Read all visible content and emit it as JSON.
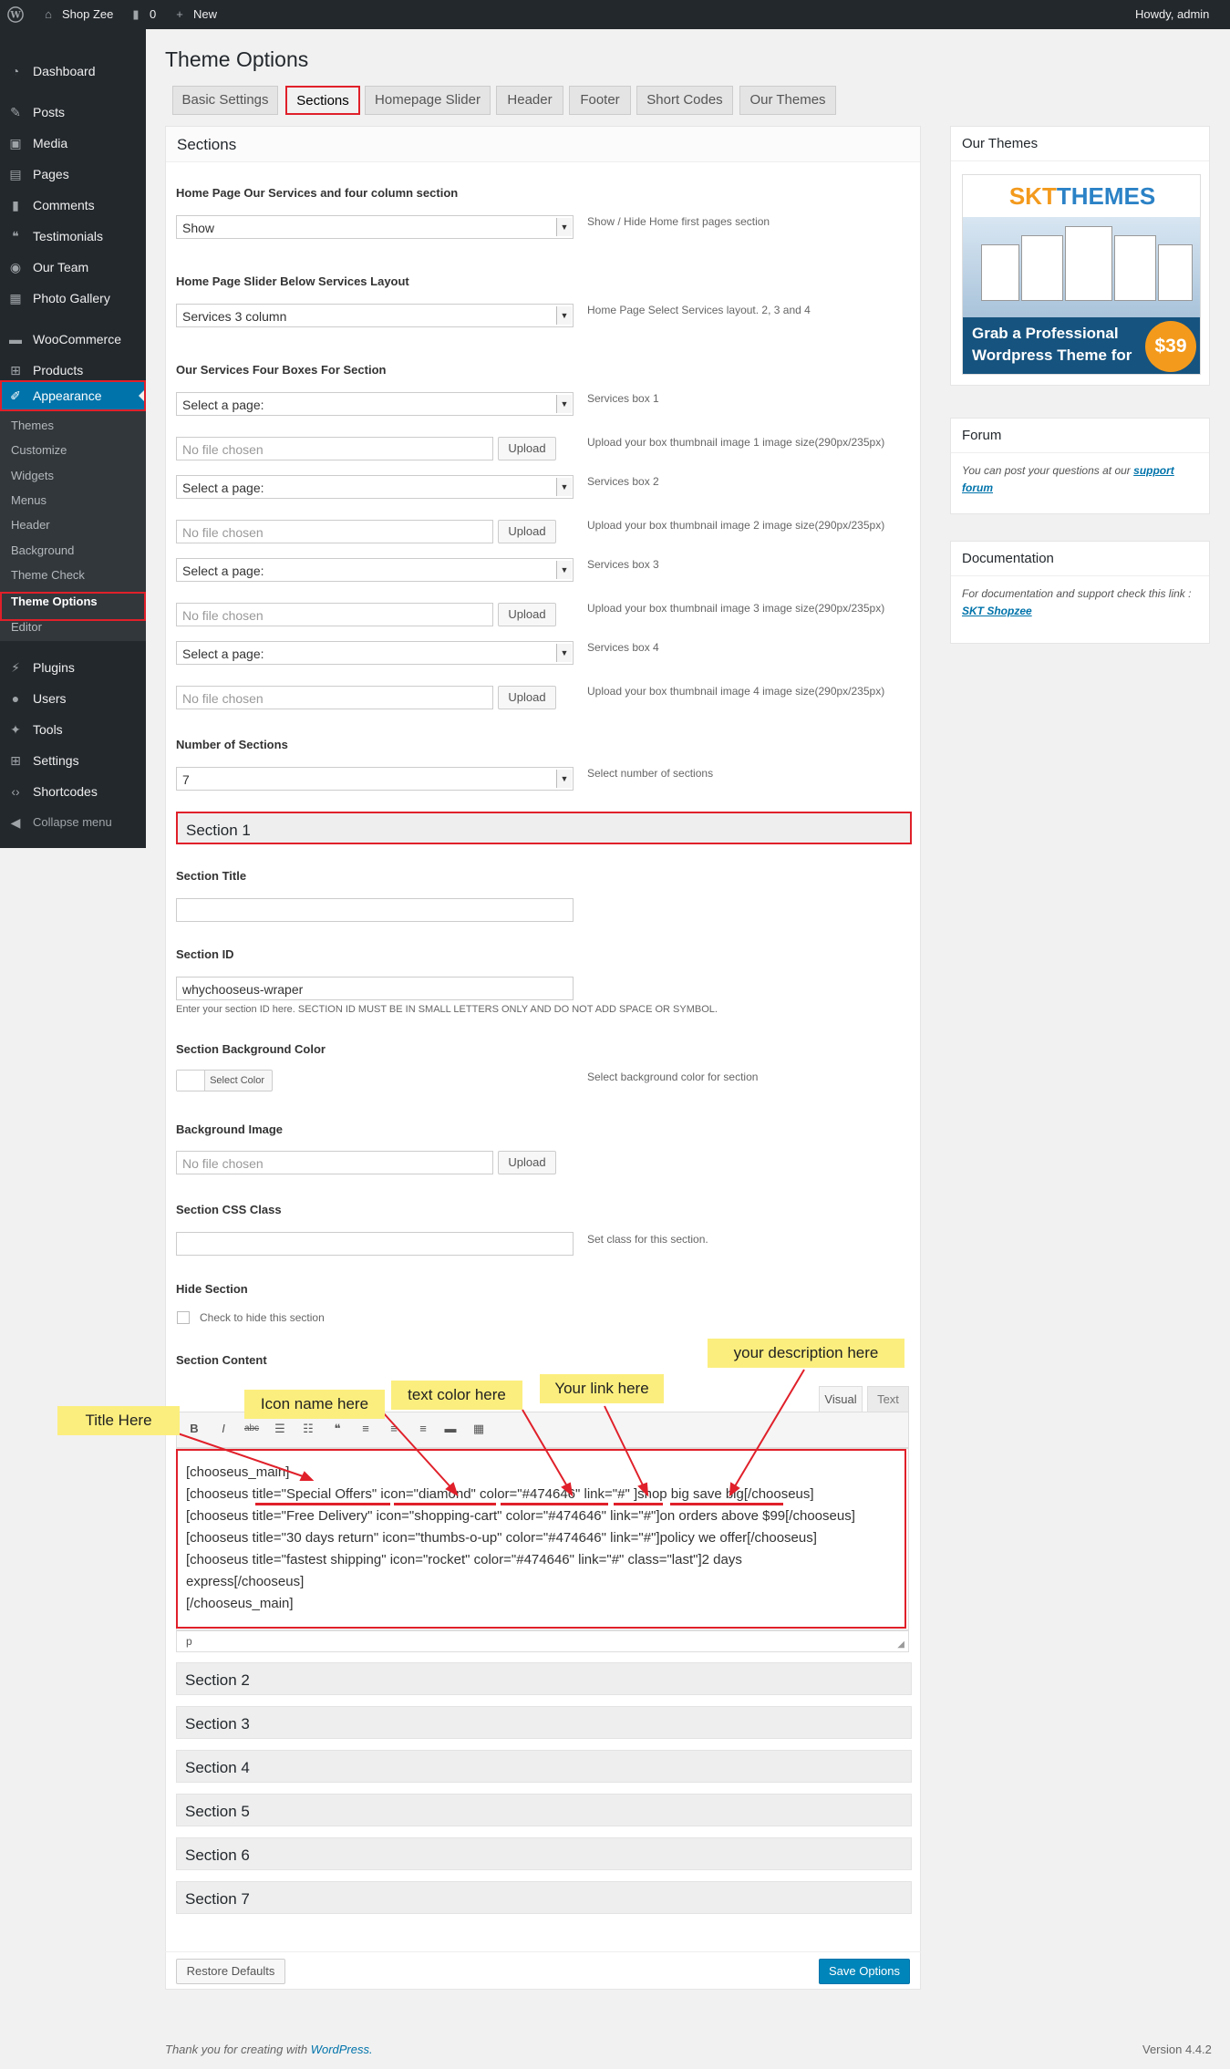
{
  "adminbar": {
    "site": "Shop Zee",
    "comments": "0",
    "new": "New",
    "howdy": "Howdy, admin"
  },
  "sidebar": {
    "items": [
      {
        "label": "Dashboard",
        "icon": "dashboard-icon"
      },
      {
        "label": "Posts",
        "icon": "pin-icon"
      },
      {
        "label": "Media",
        "icon": "media-icon"
      },
      {
        "label": "Pages",
        "icon": "pages-icon"
      },
      {
        "label": "Comments",
        "icon": "comment-icon"
      },
      {
        "label": "Testimonials",
        "icon": "quote-icon"
      },
      {
        "label": "Our Team",
        "icon": "team-icon"
      },
      {
        "label": "Photo Gallery",
        "icon": "gallery-icon"
      },
      {
        "label": "WooCommerce",
        "icon": "woocommerce-icon"
      },
      {
        "label": "Products",
        "icon": "cart-icon"
      },
      {
        "label": "Appearance",
        "icon": "brush-icon"
      }
    ],
    "sub": [
      "Themes",
      "Customize",
      "Widgets",
      "Menus",
      "Header",
      "Background",
      "Theme Check",
      "Theme Options",
      "Editor"
    ],
    "bottom": [
      {
        "label": "Plugins",
        "icon": "plugin-icon"
      },
      {
        "label": "Users",
        "icon": "user-icon"
      },
      {
        "label": "Tools",
        "icon": "wrench-icon"
      },
      {
        "label": "Settings",
        "icon": "settings-icon"
      },
      {
        "label": "Shortcodes",
        "icon": "code-icon"
      },
      {
        "label": "Collapse menu",
        "icon": "collapse-icon"
      }
    ]
  },
  "page": {
    "title": "Theme Options",
    "tabs": [
      "Basic Settings",
      "Sections",
      "Homepage Slider",
      "Header",
      "Footer",
      "Short Codes",
      "Our Themes"
    ],
    "panel_title": "Sections"
  },
  "form": {
    "services_section": {
      "label": "Home Page Our Services and four column section",
      "value": "Show",
      "desc": "Show / Hide Home first pages section"
    },
    "services_layout": {
      "label": "Home Page Slider Below Services Layout",
      "value": "Services 3 column",
      "desc": "Home Page Select Services layout. 2, 3 and 4"
    },
    "boxes_label": "Our Services Four Boxes For Section",
    "boxes": [
      {
        "select": "Select a page:",
        "desc": "Services box 1",
        "file": "No file chosen",
        "upload": "Upload",
        "file_desc": "Upload your box thumbnail image 1 image size(290px/235px)"
      },
      {
        "select": "Select a page:",
        "desc": "Services box 2",
        "file": "No file chosen",
        "upload": "Upload",
        "file_desc": "Upload your box thumbnail image 2 image size(290px/235px)"
      },
      {
        "select": "Select a page:",
        "desc": "Services box 3",
        "file": "No file chosen",
        "upload": "Upload",
        "file_desc": "Upload your box thumbnail image 3 image size(290px/235px)"
      },
      {
        "select": "Select a page:",
        "desc": "Services box 4",
        "file": "No file chosen",
        "upload": "Upload",
        "file_desc": "Upload your box thumbnail image 4 image size(290px/235px)"
      }
    ],
    "num_sections": {
      "label": "Number of Sections",
      "value": "7",
      "desc": "Select number of sections"
    },
    "section1": {
      "heading": "Section 1",
      "title_label": "Section Title",
      "id_label": "Section ID",
      "id_value": "whychooseus-wraper",
      "id_desc": "Enter your section ID here. SECTION ID MUST BE IN SMALL LETTERS ONLY AND DO NOT ADD SPACE OR SYMBOL.",
      "bg_label": "Section Background Color",
      "bg_button": "Select Color",
      "bg_desc": "Select background color for section",
      "bgimg_label": "Background Image",
      "bgimg_file": "No file chosen",
      "bgimg_upload": "Upload",
      "css_label": "Section CSS Class",
      "css_desc": "Set class for this section.",
      "hide_label": "Hide Section",
      "hide_check": "Check to hide this section",
      "content_label": "Section Content",
      "tab_visual": "Visual",
      "tab_text": "Text",
      "content_lines": [
        "[chooseus_main]",
        "[chooseus title=\"Special Offers\" icon=\"diamond\" color=\"#474646\" link=\"#\" ]shop big save big[/chooseus]",
        "[chooseus title=\"Free Delivery\" icon=\"shopping-cart\" color=\"#474646\" link=\"#\"]on orders above $99[/chooseus]",
        "[chooseus title=\"30 days return\" icon=\"thumbs-o-up\" color=\"#474646\" link=\"#\"]policy we offer[/chooseus]",
        "[chooseus title=\"fastest shipping\" icon=\"rocket\" color=\"#474646\" link=\"#\" class=\"last\"]2 days",
        "express[/chooseus]",
        "[/chooseus_main]"
      ],
      "path": "p"
    },
    "other_sections": [
      "Section 2",
      "Section 3",
      "Section 4",
      "Section 5",
      "Section 6",
      "Section 7"
    ],
    "restore": "Restore Defaults",
    "save": "Save Options"
  },
  "notes": {
    "title": "Title Here",
    "icon": "Icon name here",
    "color": "text color here",
    "link": "Your link here",
    "desc": "your description here"
  },
  "right": {
    "themes_title": "Our Themes",
    "banner_brand_a": "SKT",
    "banner_brand_b": "THEMES",
    "banner_line1": "Grab a Professional",
    "banner_line2": "Wordpress Theme for",
    "banner_price": "$39",
    "forum_title": "Forum",
    "forum_text": "You can post your questions at our",
    "forum_link": "support forum",
    "doc_title": "Documentation",
    "doc_text": "For documentation and support check this link :",
    "doc_link": "SKT Shopzee"
  },
  "footer": {
    "thanks": "Thank you for creating with",
    "wp": "WordPress.",
    "version": "Version 4.4.2"
  },
  "colors": {
    "accent": "#0073aa",
    "highlight": "#e0202a",
    "note": "#fbee7e",
    "adminbar": "#23282d"
  }
}
